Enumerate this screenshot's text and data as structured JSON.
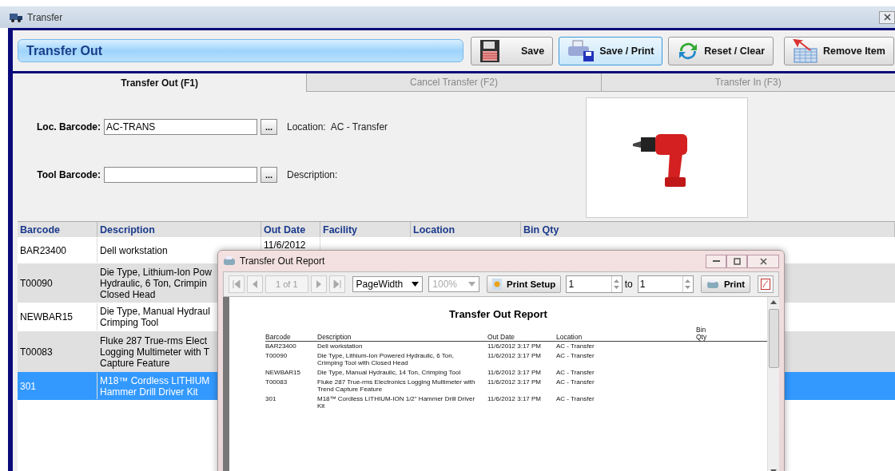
{
  "window": {
    "title": "Transfer"
  },
  "header": {
    "title": "Transfer Out"
  },
  "toolbar_buttons": [
    {
      "label": "Save",
      "kind": "save",
      "selected": false
    },
    {
      "label": "Save / Print",
      "kind": "save-print",
      "selected": true
    },
    {
      "label": "Reset / Clear",
      "kind": "reset",
      "selected": false
    },
    {
      "label": "Remove Item",
      "kind": "remove",
      "selected": false
    }
  ],
  "tabs": [
    {
      "label": "Transfer Out (F1)",
      "selected": true
    },
    {
      "label": "Cancel Transfer (F2)",
      "selected": false
    },
    {
      "label": "Transfer In (F3)",
      "selected": false
    }
  ],
  "form": {
    "fields": [
      {
        "label": "Loc. Barcode:",
        "value": "AC-TRANS",
        "browse": "...",
        "info_label": "Location:",
        "info_value": "AC - Transfer"
      },
      {
        "label": "Tool Barcode:",
        "browse": "...",
        "info_label": "Description:"
      }
    ]
  },
  "table": {
    "columns": [
      "Barcode",
      "Description",
      "Out Date",
      "Facility",
      "Location",
      "Bin Qty"
    ],
    "rows": [
      {
        "selected": false,
        "cells": [
          "BAR23400",
          "Dell workstation",
          "11/6/2012"
        ]
      },
      {
        "selected": false,
        "cells": [
          "T00090",
          "Die Type, Lithium-Ion Pow\nHydraulic, 6 Ton, Crimpin\nClosed Head"
        ]
      },
      {
        "selected": false,
        "cells": [
          "NEWBAR15",
          "Die Type, Manual Hydraul\nCrimping Tool"
        ]
      },
      {
        "selected": false,
        "cells": [
          "T00083",
          "Fluke 287 True-rms Elect\nLogging Multimeter with T\nCapture Feature"
        ]
      },
      {
        "selected": true,
        "cells": [
          "301",
          "M18™ Cordless LITHIUM\nHammer Drill Driver Kit"
        ]
      }
    ]
  },
  "report_dialog": {
    "title": "Transfer Out Report",
    "page": "1 of 1",
    "zoom_mode": "PageWidth",
    "zoom_percent": "100%",
    "print_setup": "Print Setup",
    "from_page": "1",
    "to_label": "to",
    "to_page": "1",
    "print": "Print",
    "report": {
      "title": "Transfer Out Report",
      "columns": [
        "Barcode",
        "Description",
        "Out Date",
        "Location",
        "Bin\nQty"
      ],
      "rows": [
        [
          "BAR23400",
          "Dell workstation",
          "11/6/2012 3:17 PM",
          "AC - Transfer"
        ],
        [
          "T00090",
          "Die Type, Lithium-Ion Powered Hydraulic, 6 Ton,\nCrimping Tool with Closed Head",
          "11/6/2012 3:17 PM",
          "AC - Transfer"
        ],
        [
          "NEWBAR15",
          "Die Type, Manual Hydraulic, 14 Ton, Crimping Tool",
          "11/6/2012 3:17 PM",
          "AC - Transfer"
        ],
        [
          "T00083",
          "Fluke 287 True-rms Electronics Logging Multimeter with\nTrend Capture Feature",
          "11/6/2012 3:17 PM",
          "AC - Transfer"
        ],
        [
          "301",
          "M18™ Cordless LITHIUM-ION 1/2\" Hammer Drill Driver\nKit",
          "11/6/2012 3:17 PM",
          "AC - Transfer"
        ]
      ]
    }
  }
}
